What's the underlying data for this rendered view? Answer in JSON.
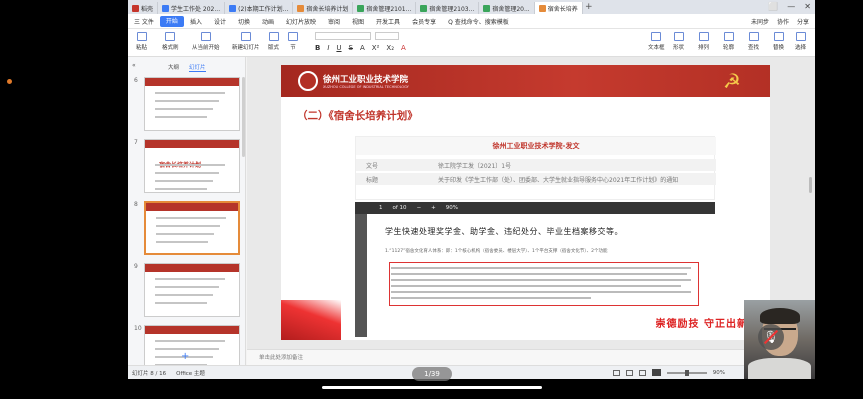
{
  "tabs": [
    {
      "label": "稻壳",
      "color": "#c5352b"
    },
    {
      "label": "学生工作处 202...",
      "color": "#3c7bf5"
    },
    {
      "label": "(2)本期工作计划...",
      "color": "#3c7bf5"
    },
    {
      "label": "宿舍长培养计划",
      "color": "#e58b3a"
    },
    {
      "label": "宿舍管理2101...",
      "color": "#3aa55b"
    },
    {
      "label": "宿舍管理2103...",
      "color": "#3aa55b"
    },
    {
      "label": "宿舍管理20...",
      "color": "#3aa55b"
    },
    {
      "label": "宿舍长培养",
      "color": "#e58b3a"
    }
  ],
  "tab_plus": "+",
  "window_controls": [
    "⬜",
    "—",
    "✕"
  ],
  "menu": {
    "items": [
      "三 文件",
      "开始",
      "插入",
      "设计",
      "切换",
      "动画",
      "幻灯片放映",
      "审阅",
      "视图",
      "开发工具",
      "会员专享",
      "Q 查找命令、搜索模板"
    ],
    "active_index": 1,
    "right": [
      "未同步",
      "协作",
      "分享"
    ]
  },
  "ribbon": {
    "buttons": [
      "粘贴",
      "格式刷",
      "从当前开始",
      "新建幻灯片",
      "版式",
      "节",
      "重置"
    ],
    "format": [
      "B",
      "I",
      "U",
      "S",
      "A",
      "X²",
      "X₂",
      "A"
    ],
    "right_buttons": [
      "文本框",
      "形状",
      "排列",
      "轮廓",
      "查找",
      "替换",
      "选择"
    ]
  },
  "left_panel": {
    "tabs": [
      "大纲",
      "幻灯片"
    ],
    "selected_tab": 1,
    "thumbnails": [
      {
        "num": "6",
        "text": ""
      },
      {
        "num": "7",
        "text": "宿舍长培养计划"
      },
      {
        "num": "8",
        "text": ""
      },
      {
        "num": "9",
        "text": ""
      },
      {
        "num": "10",
        "text": ""
      }
    ],
    "selected_index": 2,
    "add_label": "+"
  },
  "slide": {
    "school": "徐州工业职业技术学院",
    "school_en": "XUZHOU COLLEGE OF INDUSTRIAL TECHNOLOGY",
    "title": "（二）《宿舍长培养计划》",
    "doc_title": "徐州工业职业技术学院-发文",
    "doc_rows": [
      {
        "k": "文号",
        "v": "徐工院学工发〔2021〕1号"
      },
      {
        "k": "标题",
        "v": "关于印发《学生工作部（处）、团委部、大学生就业指导服务中心2021年工作计划》的通知"
      }
    ],
    "pdf_toolbar": [
      "1",
      "of 10",
      "−",
      "+",
      "90%"
    ],
    "pdf_heading": "学生快速处理奖学金、助学金、违纪处分、毕业生档案移交等。",
    "pdf_note": "1.“1127”宿舍文化育人体系：即：1个核心机构（宿舍委员、楼层大学）、1个平台支撑（宿舍文化节）、2个功能",
    "slogan": "崇德励技  守正出新"
  },
  "notes": "单击此处添加备注",
  "status": {
    "left": [
      "幻灯片 8 / 16",
      "Office 主题"
    ],
    "zoom": "90%"
  },
  "pager": "1/39",
  "camera": {
    "mic_icon": "🎙"
  }
}
